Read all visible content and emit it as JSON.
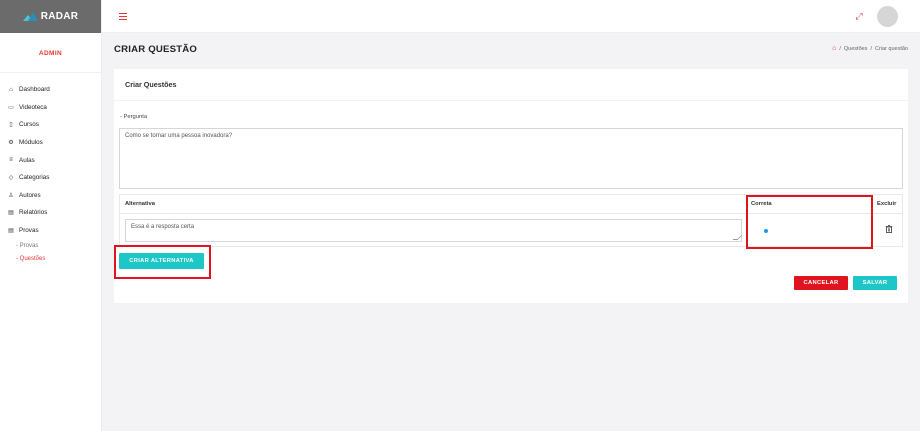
{
  "brand": {
    "name": "RADAR"
  },
  "sidebar": {
    "role": "ADMIN",
    "items": [
      {
        "label": "Dashboard",
        "icon": "home-icon",
        "glyph": "⌂"
      },
      {
        "label": "Videoteca",
        "icon": "video-icon",
        "glyph": "▭"
      },
      {
        "label": "Cursos",
        "icon": "document-icon",
        "glyph": "▯"
      },
      {
        "label": "Módulos",
        "icon": "gear-icon",
        "glyph": "⚙"
      },
      {
        "label": "Aulas",
        "icon": "list-icon",
        "glyph": "≡"
      },
      {
        "label": "Categorias",
        "icon": "tag-icon",
        "glyph": "◇"
      },
      {
        "label": "Autores",
        "icon": "users-icon",
        "glyph": "♙"
      },
      {
        "label": "Relatórios",
        "icon": "report-icon",
        "glyph": "▤"
      },
      {
        "label": "Provas",
        "icon": "exam-icon",
        "glyph": "▤"
      }
    ],
    "subitems": [
      {
        "label": "- Provas",
        "active": false
      },
      {
        "label": "- Questões",
        "active": true
      }
    ]
  },
  "header": {
    "title": "CRIAR QUESTÃO",
    "breadcrumb": [
      "Questões",
      "Criar questão"
    ]
  },
  "card": {
    "title": "Criar Questões",
    "question_label": "- Pergunta",
    "question_value": "Como se tornar uma pessoa inovadora?",
    "table": {
      "col_alternativa": "Alternativa",
      "col_correta": "Correta",
      "col_excluir": "Excluir",
      "rows": [
        {
          "text": "Essa é a resposta certa",
          "correct": true
        }
      ]
    },
    "add_alternative_label": "CRIAR ALTERNATIVA",
    "cancel_label": "CANCELAR",
    "save_label": "SALVAR"
  },
  "colors": {
    "accent_red": "#e53935",
    "teal": "#1ec7c7",
    "cancel_red": "#e0141f",
    "radio_blue": "#2196f3"
  }
}
